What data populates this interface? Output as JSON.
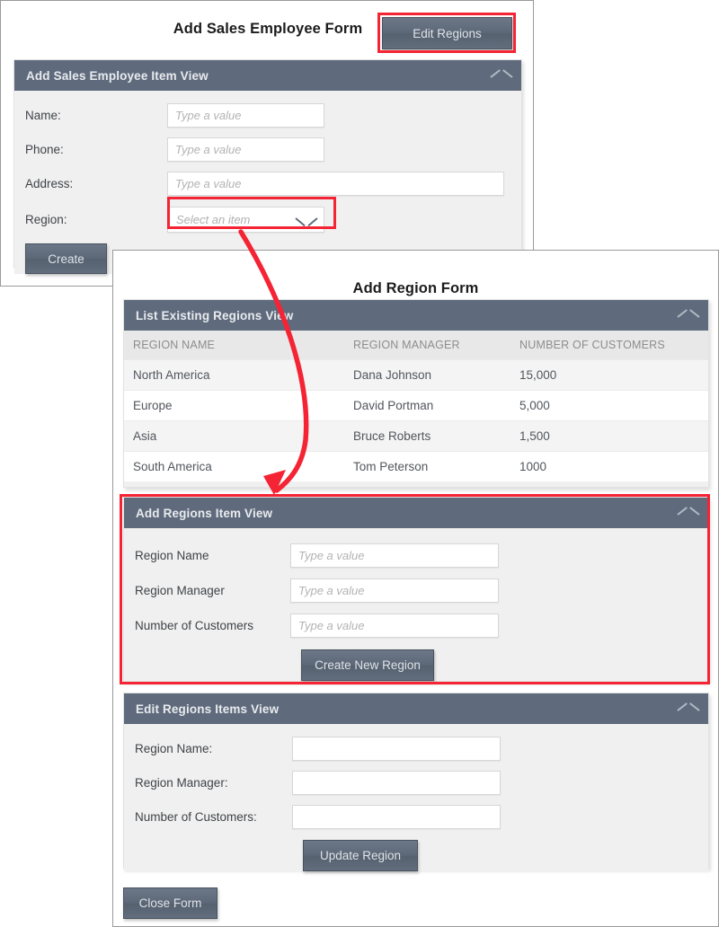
{
  "employee_window": {
    "title": "Add Sales Employee Form",
    "edit_regions_button": "Edit Regions",
    "panel": {
      "header": "Add Sales Employee Item View",
      "collapse_icon": "chevron-up-icon",
      "fields": [
        {
          "label": "Name:",
          "placeholder": "Type a value"
        },
        {
          "label": "Phone:",
          "placeholder": "Type a value"
        },
        {
          "label": "Address:",
          "placeholder": "Type a value"
        }
      ],
      "region_field": {
        "label": "Region:",
        "placeholder": "Select an item",
        "dropdown_icon": "chevron-down-icon"
      },
      "create_button": "Create"
    }
  },
  "region_window": {
    "title": "Add Region Form",
    "list_panel": {
      "header": "List Existing Regions View",
      "collapse_icon": "chevron-up-icon",
      "columns": [
        "REGION NAME",
        "REGION MANAGER",
        "NUMBER OF CUSTOMERS"
      ],
      "rows": [
        [
          "North America",
          "Dana Johnson",
          "15,000"
        ],
        [
          "Europe",
          "David Portman",
          "5,000"
        ],
        [
          "Asia",
          "Bruce Roberts",
          "1,500"
        ],
        [
          "South America",
          "Tom Peterson",
          "1000"
        ]
      ]
    },
    "add_panel": {
      "header": "Add Regions Item View",
      "collapse_icon": "chevron-up-icon",
      "fields": [
        {
          "label": "Region Name",
          "placeholder": "Type a value"
        },
        {
          "label": "Region Manager",
          "placeholder": "Type a value"
        },
        {
          "label": "Number of Customers",
          "placeholder": "Type a value"
        }
      ],
      "submit_button": "Create New Region"
    },
    "edit_panel": {
      "header": "Edit Regions Items View",
      "collapse_icon": "chevron-up-icon",
      "fields": [
        {
          "label": "Region Name:",
          "value": ""
        },
        {
          "label": "Region Manager:",
          "value": ""
        },
        {
          "label": "Number of Customers:",
          "value": ""
        }
      ],
      "submit_button": "Update Region"
    },
    "close_button": "Close Form"
  },
  "annotations": {
    "accent_color": "#f42434",
    "highlight_targets": [
      "edit-regions-button",
      "region-select",
      "add-regions-item-view-panel"
    ],
    "arrow": "curved-arrow-from-region-select-to-add-regions-panel"
  }
}
